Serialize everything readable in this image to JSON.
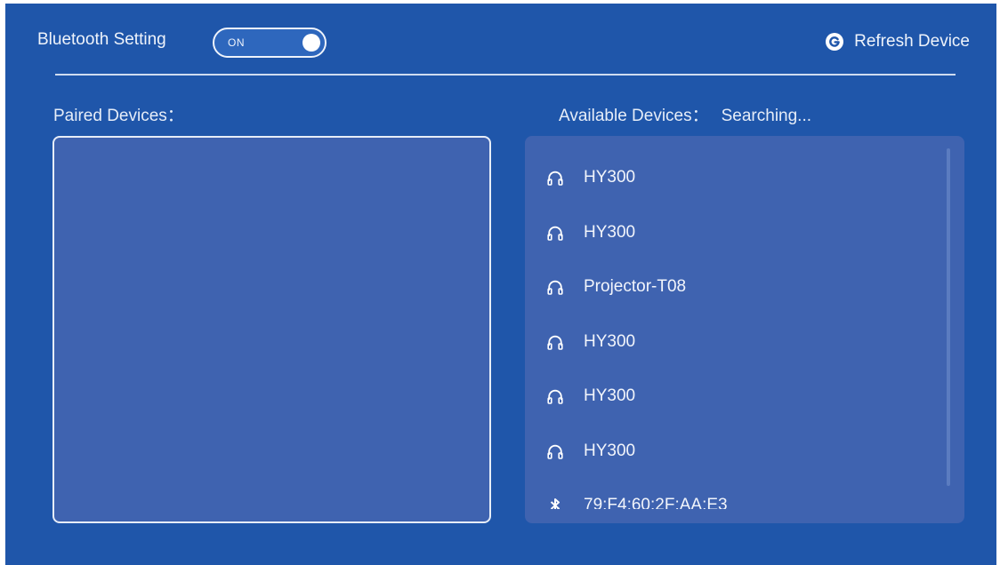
{
  "header": {
    "bluetooth_label": "Bluetooth Setting",
    "toggle_state": "ON",
    "refresh_label": "Refresh Device"
  },
  "paired": {
    "title": "Paired Devices：",
    "devices": []
  },
  "available": {
    "title": "Available Devices：",
    "status": "Searching...",
    "devices": [
      {
        "name": "HY300",
        "icon": "headphones-icon"
      },
      {
        "name": "HY300",
        "icon": "headphones-icon"
      },
      {
        "name": "Projector-T08",
        "icon": "headphones-icon"
      },
      {
        "name": "HY300",
        "icon": "headphones-icon"
      },
      {
        "name": "HY300",
        "icon": "headphones-icon"
      },
      {
        "name": "HY300",
        "icon": "headphones-icon"
      },
      {
        "name": "79:F4:60:2F:AA:E3",
        "icon": "bluetooth-icon"
      }
    ]
  },
  "colors": {
    "background": "#1f56aa",
    "panel": "#3f63b0",
    "text": "#eef3fb"
  }
}
